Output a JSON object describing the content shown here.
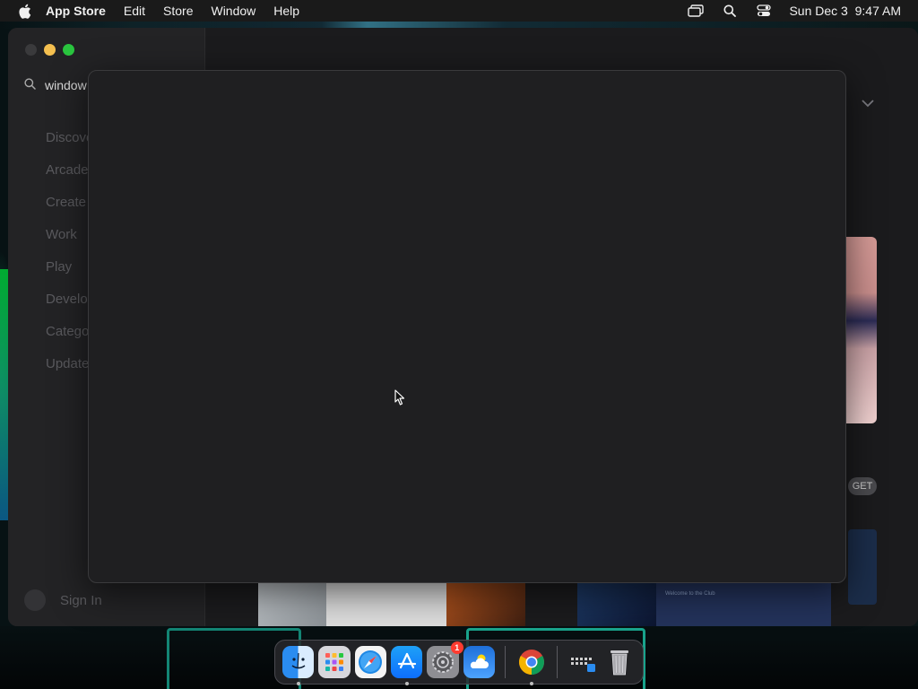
{
  "menubar": {
    "app_name": "App Store",
    "menus": [
      "Edit",
      "Store",
      "Window",
      "Help"
    ],
    "clock": "Sun Dec 3  9:47 AM"
  },
  "sidebar": {
    "search_value": "window",
    "items": [
      {
        "label": "Discover"
      },
      {
        "label": "Arcade"
      },
      {
        "label": "Create"
      },
      {
        "label": "Work"
      },
      {
        "label": "Play"
      },
      {
        "label": "Develop"
      },
      {
        "label": "Categories"
      },
      {
        "label": "Updates"
      }
    ],
    "signin_label": "Sign In"
  },
  "main": {
    "get_button_label": "GET",
    "preview_caption": "Welcome to the Club"
  },
  "dock": {
    "apps": [
      {
        "name": "Finder",
        "icon": "finder-icon",
        "running": true
      },
      {
        "name": "Launchpad",
        "icon": "launchpad-icon",
        "running": false
      },
      {
        "name": "Safari",
        "icon": "safari-icon",
        "running": false
      },
      {
        "name": "App Store",
        "icon": "app-store-icon",
        "running": true
      },
      {
        "name": "System Settings",
        "icon": "settings-icon",
        "running": false,
        "badge": "1"
      },
      {
        "name": "Weather",
        "icon": "weather-icon",
        "running": false
      },
      {
        "name": "Google Chrome",
        "icon": "chrome-icon",
        "running": true
      }
    ],
    "extras": [
      {
        "name": "Downloads",
        "icon": "downloads-stack-icon"
      },
      {
        "name": "Trash",
        "icon": "trash-icon"
      }
    ]
  },
  "colors": {
    "accent_red": "#ff3b30",
    "traffic_min": "#f4bf4f",
    "traffic_max": "#2ac53f"
  }
}
